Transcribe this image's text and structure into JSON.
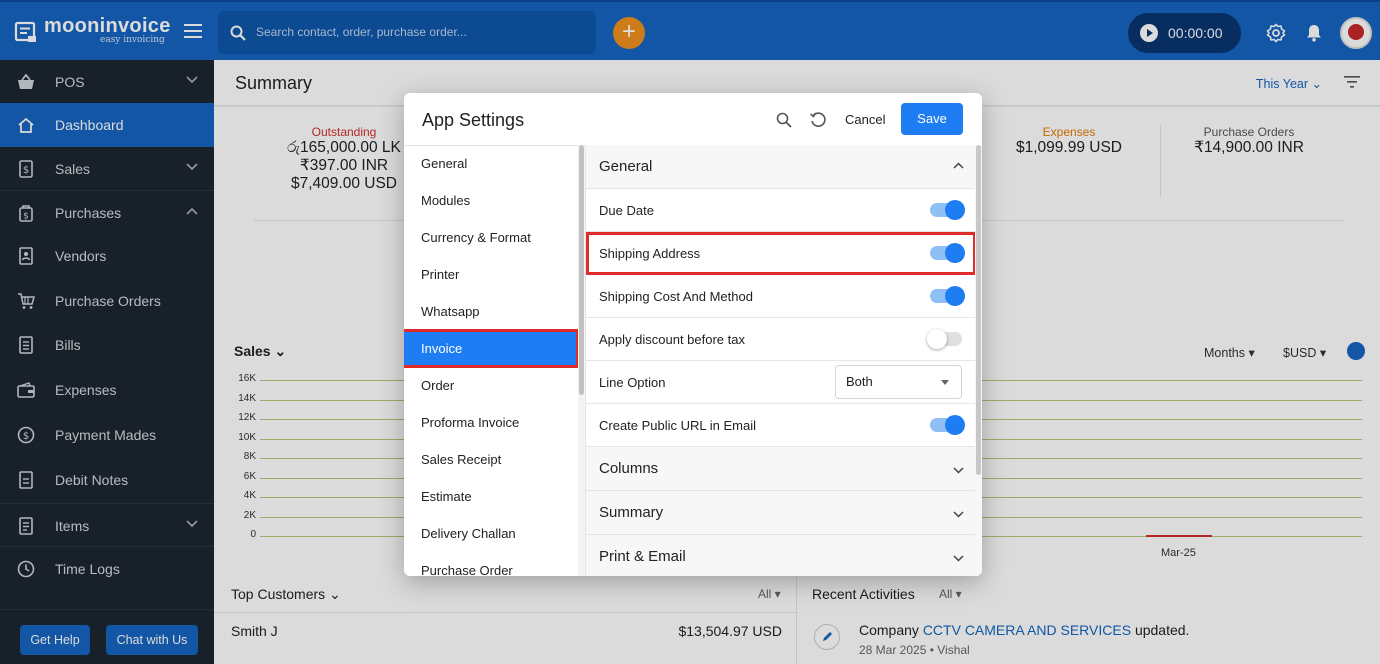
{
  "brand": {
    "name": "mooninvoice",
    "tagline": "easy invoicing"
  },
  "search": {
    "placeholder": "Search contact, order, purchase order..."
  },
  "timer": {
    "value": "00:00:00"
  },
  "sidebar": {
    "items": [
      {
        "label": "POS",
        "icon": "basket-icon"
      },
      {
        "label": "Dashboard",
        "icon": "home-icon"
      },
      {
        "label": "Sales",
        "icon": "receipt-icon"
      },
      {
        "label": "Purchases",
        "icon": "bag-icon"
      },
      {
        "label": "Vendors",
        "icon": "contacts-icon"
      },
      {
        "label": "Purchase Orders",
        "icon": "cart-icon"
      },
      {
        "label": "Bills",
        "icon": "bill-icon"
      },
      {
        "label": "Expenses",
        "icon": "wallet-icon"
      },
      {
        "label": "Payment Mades",
        "icon": "payment-icon"
      },
      {
        "label": "Debit Notes",
        "icon": "note-icon"
      },
      {
        "label": "Items",
        "icon": "list-icon"
      },
      {
        "label": "Time Logs",
        "icon": "clock-icon"
      }
    ],
    "help_label": "Get Help",
    "chat_label": "Chat with Us"
  },
  "summary": {
    "title": "Summary",
    "period": "This Year",
    "outstanding": {
      "label": "Outstanding",
      "values": [
        "රු165,000.00 LK",
        "₹397.00 INR",
        "$7,409.00 USD"
      ]
    },
    "expenses": {
      "label": "Expenses",
      "value": "$1,099.99 USD"
    },
    "purchase_orders": {
      "label": "Purchase Orders",
      "value": "₹14,900.00 INR"
    }
  },
  "sales": {
    "title": "Sales",
    "group_by": "Months",
    "currency": "$USD",
    "chart_data": {
      "type": "bar",
      "categories": [
        "Mar-25"
      ],
      "yticks": [
        "16K",
        "14K",
        "12K",
        "10K",
        "8K",
        "6K",
        "4K",
        "2K",
        "0"
      ],
      "title": "",
      "xlabel": "",
      "ylabel": "",
      "grid": true
    }
  },
  "top_customers": {
    "title": "Top Customers",
    "filter": "All",
    "rows": [
      {
        "name": "Smith J",
        "amount": "$13,504.97 USD"
      }
    ]
  },
  "recent_activities": {
    "title": "Recent Activities",
    "filter": "All",
    "items": [
      {
        "prefix": "Company",
        "link": "CCTV CAMERA AND SERVICES",
        "suffix": "updated.",
        "meta": "28 Mar 2025 • Vishal"
      }
    ]
  },
  "modal": {
    "title": "App Settings",
    "cancel_label": "Cancel",
    "save_label": "Save",
    "menu": [
      "General",
      "Modules",
      "Currency & Format",
      "Printer",
      "Whatsapp",
      "Invoice",
      "Order",
      "Proforma Invoice",
      "Sales Receipt",
      "Estimate",
      "Delivery Challan",
      "Purchase Order"
    ],
    "active_menu": "Invoice",
    "sections": {
      "general": "General",
      "columns": "Columns",
      "summary": "Summary",
      "print_email": "Print & Email"
    },
    "settings": [
      {
        "label": "Due Date",
        "type": "toggle",
        "enabled": true
      },
      {
        "label": "Shipping Address",
        "type": "toggle",
        "enabled": true
      },
      {
        "label": "Shipping Cost And Method",
        "type": "toggle",
        "enabled": true
      },
      {
        "label": "Apply discount before tax",
        "type": "toggle",
        "enabled": false
      },
      {
        "label": "Line Option",
        "type": "select",
        "value": "Both"
      },
      {
        "label": "Create Public URL in Email",
        "type": "toggle",
        "enabled": true
      }
    ]
  },
  "colors": {
    "brand_blue": "#1565c0",
    "accent_orange": "#f0911f",
    "highlight_red": "#e02b2b",
    "toggle_on": "#1e7df2"
  }
}
